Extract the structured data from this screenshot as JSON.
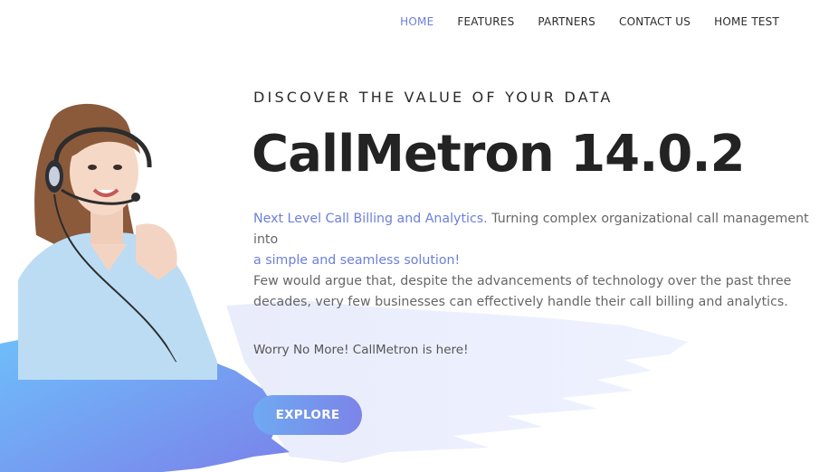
{
  "nav": {
    "items": [
      {
        "label": "HOME",
        "active": true
      },
      {
        "label": "FEATURES",
        "active": false
      },
      {
        "label": "PARTNERS",
        "active": false
      },
      {
        "label": "CONTACT US",
        "active": false
      },
      {
        "label": "HOME TEST",
        "active": false
      }
    ]
  },
  "hero": {
    "eyebrow": "DISCOVER THE VALUE OF YOUR DATA",
    "title": "CallMetron 14.0.2",
    "desc_highlight_1": "Next Level Call Billing and Analytics.",
    "desc_text_1": " Turning complex organizational call management into",
    "desc_highlight_2": "a simple and seamless solution!",
    "desc_text_2": "Few would argue that, despite the advancements of technology over the past three decades, very few businesses can effectively handle their call billing and analytics.",
    "tagline": "Worry No More! CallMetron is here!",
    "cta_label": "EXPLORE"
  },
  "colors": {
    "accent": "#6d7fd9",
    "button_start": "#6fa9f2",
    "button_end": "#7c84e8",
    "brush_blue": "#5b9df5",
    "brush_light": "#dfe6fb"
  },
  "icons": {
    "hero_image": "customer-support-agent-with-headset"
  }
}
